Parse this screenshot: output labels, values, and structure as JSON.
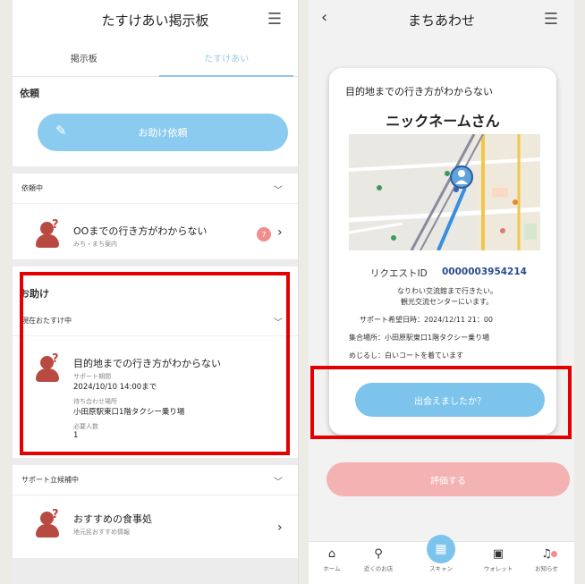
{
  "left": {
    "title": "たすけあい掲示板",
    "tabs": [
      "掲示板",
      "たすけあい"
    ],
    "request_section": "依頼",
    "request_button": "お助け依頼",
    "in_request_header": "依頼中",
    "in_request_item": {
      "title": "OOまでの行き方がわからない",
      "category": "みち・まち案内",
      "badge": "7"
    },
    "help_section": "お助け",
    "helping_header": "現在おたすけ中",
    "helping_item": {
      "title": "目的地までの行き方がわからない",
      "period_label": "サポート期間",
      "period_value": "2024/10/10 14:00まで",
      "place_label": "待ち合わせ場所",
      "place_value": "小田原駅東口1階タクシー乗り場",
      "people_label": "必要人数",
      "people_value": "1"
    },
    "candidate_header": "サポート立候補中",
    "candidate_item": {
      "title": "おすすめの食事処",
      "category": "地元民おすすめ情報"
    }
  },
  "right": {
    "title": "まちあわせ",
    "card": {
      "subtitle": "目的地までの行き方がわからない",
      "nickname": "ニックネームさん",
      "request_id_label": "リクエストID",
      "request_id": "0000003954214",
      "message_line1": "なりわい交流館まで行きたい。",
      "message_line2": "観光交流センターにいます。",
      "support_time": "サポート希望日時：2024/12/11 21：00",
      "meeting_place": "集合場所：小田原駅東口1階タクシー乗り場",
      "landmark": "めじるし：白いコートを着ています",
      "meet_button": "出会えましたか？"
    },
    "evaluate_button": "評価する",
    "nav": [
      "ホーム",
      "近くのお店",
      "スキャン",
      "ウォレット",
      "お知らせ"
    ]
  }
}
